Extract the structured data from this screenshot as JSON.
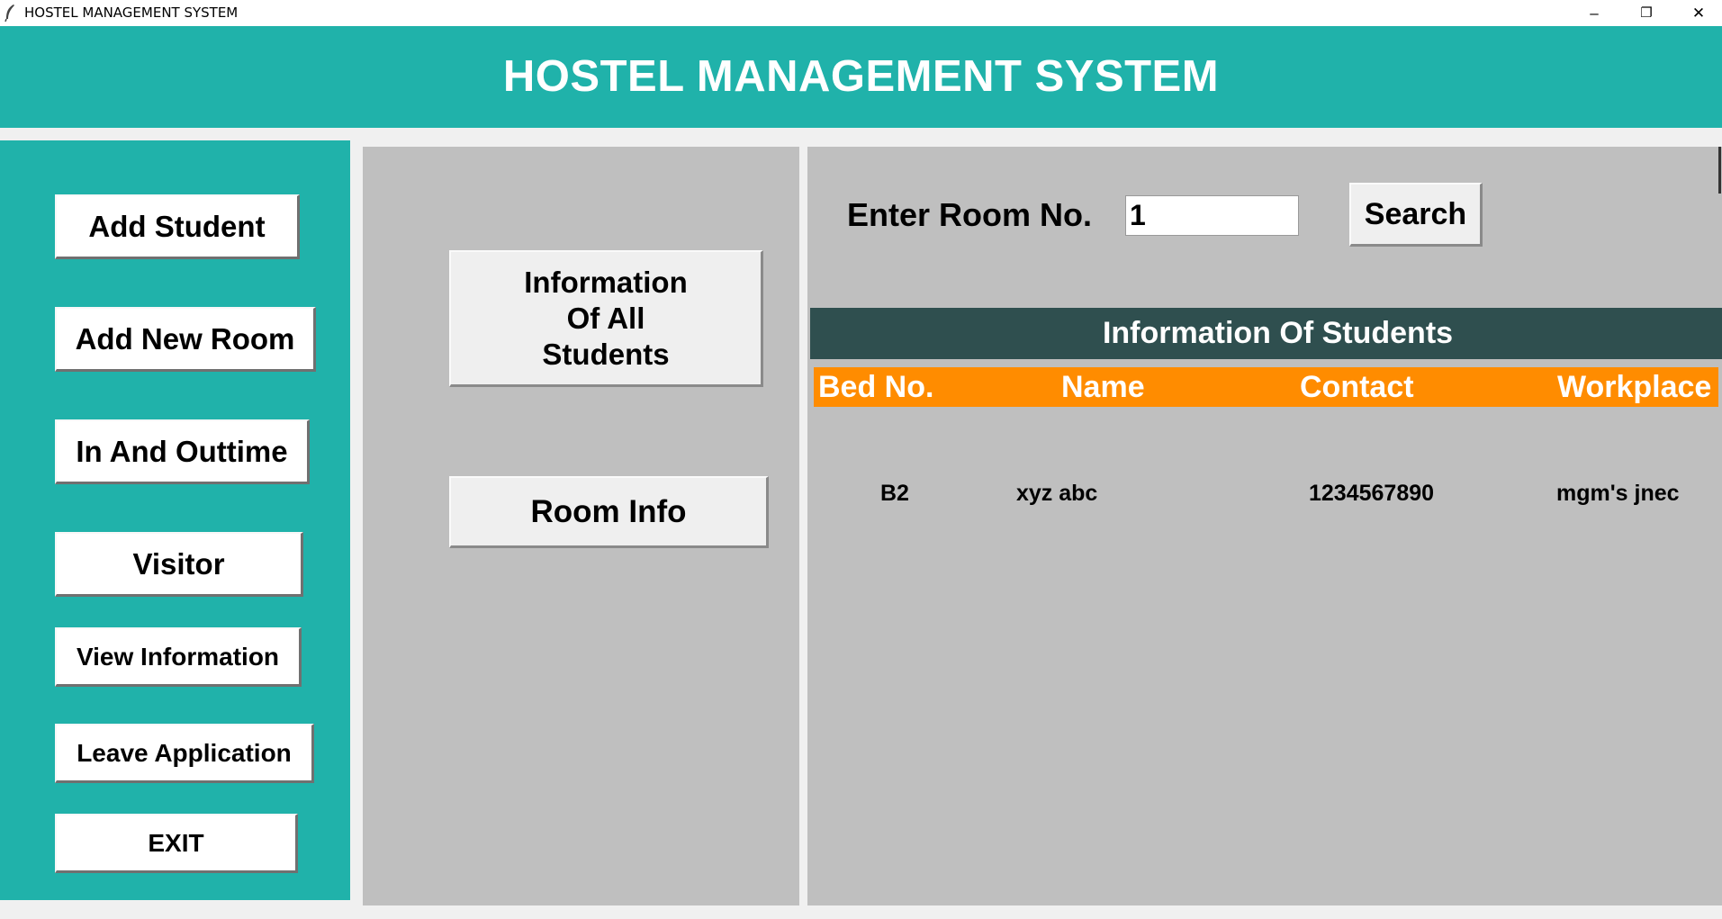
{
  "window": {
    "title": "HOSTEL MANAGEMENT SYSTEM",
    "app_icon": "feather-icon",
    "minimize_glyph": "–",
    "restore_glyph": "❐",
    "close_glyph": "✕"
  },
  "banner": {
    "title": "HOSTEL MANAGEMENT SYSTEM"
  },
  "sidebar": {
    "items": [
      {
        "label": "Add Student"
      },
      {
        "label": "Add New Room"
      },
      {
        "label": "In And Outtime"
      },
      {
        "label": "Visitor"
      },
      {
        "label": "View Information"
      },
      {
        "label": "Leave Application"
      },
      {
        "label": "EXIT"
      }
    ]
  },
  "middle": {
    "info_all_line1": "Information",
    "info_all_line2": "Of All",
    "info_all_line3": "Students",
    "room_info": "Room Info"
  },
  "search": {
    "label": "Enter Room No.",
    "value": "1",
    "button": "Search"
  },
  "table": {
    "title": "Information Of Students",
    "columns": [
      "Bed No.",
      "Name",
      "Contact",
      "Workplace"
    ],
    "rows": [
      [
        "B2",
        "xyz abc",
        "1234567890",
        "mgm's jnec"
      ]
    ]
  },
  "colors": {
    "accent_teal": "#20b2aa",
    "panel_gray": "#bfbfbf",
    "header_dark": "#2f4f4f",
    "column_orange": "#ff8c00"
  }
}
